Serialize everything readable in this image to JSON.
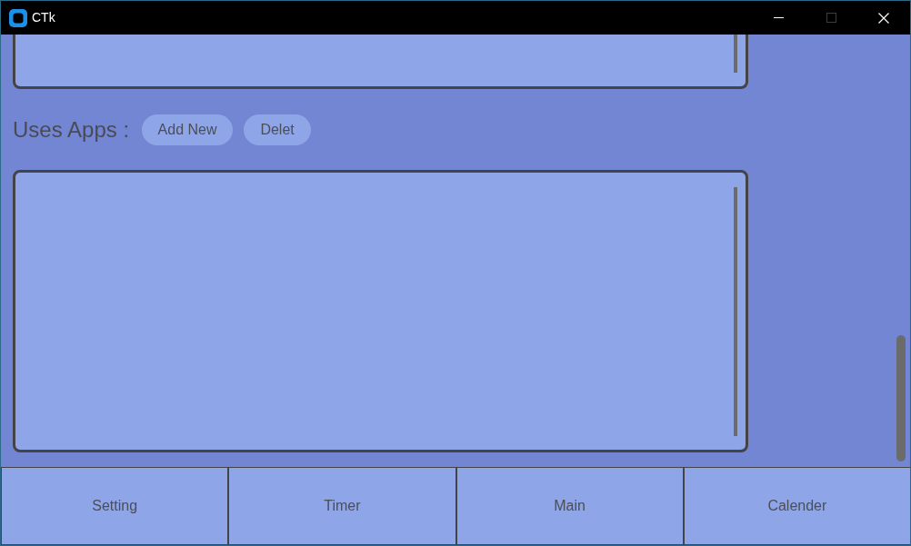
{
  "window": {
    "title": "CTk",
    "controls": [
      {
        "kind": "minimize",
        "disabled": false
      },
      {
        "kind": "maximize",
        "disabled": true
      },
      {
        "kind": "close",
        "disabled": false
      }
    ]
  },
  "apps_section": {
    "label": "Uses Apps :",
    "buttons": [
      "Add New",
      "Delet"
    ]
  },
  "nav_tabs": [
    {
      "label": "Setting"
    },
    {
      "label": "Timer"
    },
    {
      "label": "Main"
    },
    {
      "label": "Calender"
    }
  ]
}
